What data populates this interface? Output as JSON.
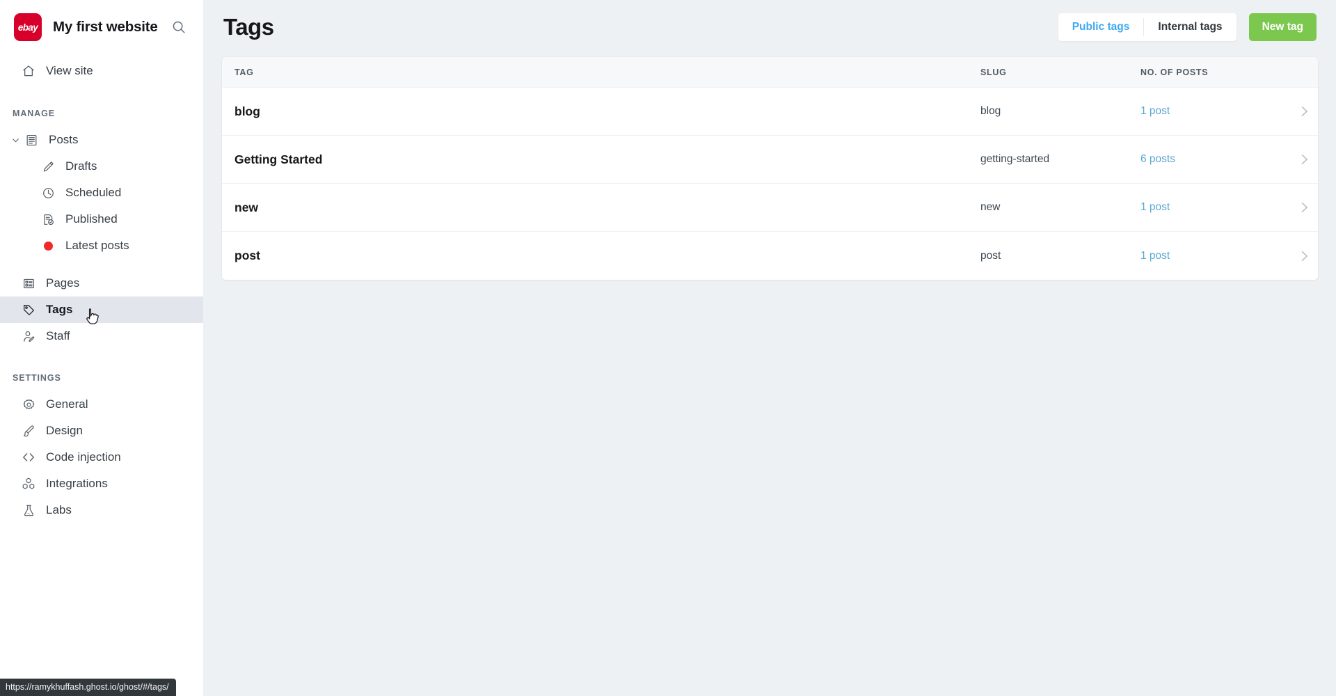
{
  "sidebar": {
    "logo_text": "ebay",
    "logo_color": "#d6002a",
    "site_title": "My first website",
    "search_icon": "search-icon",
    "view_site": {
      "label": "View site",
      "icon": "home-icon"
    },
    "manage_label": "MANAGE",
    "settings_label": "SETTINGS",
    "manage_items": [
      {
        "label": "Posts",
        "icon": "posts-icon",
        "expanded": true
      },
      {
        "label": "Drafts",
        "icon": "pencil-icon"
      },
      {
        "label": "Scheduled",
        "icon": "clock-icon"
      },
      {
        "label": "Published",
        "icon": "published-check-icon"
      },
      {
        "label": "Latest posts",
        "icon": "red-dot-icon"
      },
      {
        "label": "Pages",
        "icon": "pages-icon"
      },
      {
        "label": "Tags",
        "icon": "tag-icon",
        "active": true
      },
      {
        "label": "Staff",
        "icon": "staff-icon"
      }
    ],
    "settings_items": [
      {
        "label": "General",
        "icon": "gear-icon"
      },
      {
        "label": "Design",
        "icon": "paintbrush-icon"
      },
      {
        "label": "Code injection",
        "icon": "code-brackets-icon"
      },
      {
        "label": "Integrations",
        "icon": "integrations-cubes-icon"
      },
      {
        "label": "Labs",
        "icon": "flask-icon"
      }
    ],
    "status_url": "https://ramykhuffash.ghost.io/ghost/#/tags/"
  },
  "header": {
    "title": "Tags",
    "tabs": [
      {
        "label": "Public tags",
        "selected": true
      },
      {
        "label": "Internal tags",
        "selected": false
      }
    ],
    "new_tag_label": "New tag",
    "new_tag_color": "#7cc84f",
    "accent_color": "#3eaaef"
  },
  "table": {
    "columns": [
      "TAG",
      "SLUG",
      "NO. OF POSTS"
    ],
    "rows": [
      {
        "tag": "blog",
        "slug": "blog",
        "posts": "1 post"
      },
      {
        "tag": "Getting Started",
        "slug": "getting-started",
        "posts": "6 posts"
      },
      {
        "tag": "new",
        "slug": "new",
        "posts": "1 post"
      },
      {
        "tag": "post",
        "slug": "post",
        "posts": "1 post"
      }
    ]
  }
}
